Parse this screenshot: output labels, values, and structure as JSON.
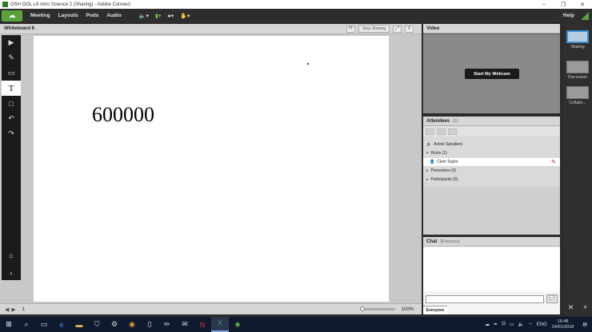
{
  "window": {
    "title": "OSH OOL L6 Intro Science 2 (Sharing) - Adobe Connect",
    "controls": [
      "–",
      "❐",
      "✕"
    ]
  },
  "menubar": {
    "items": [
      "Meeting",
      "Layouts",
      "Pods",
      "Audio"
    ],
    "help": "Help"
  },
  "whiteboard": {
    "title": "Whiteboard 6",
    "stop_sharing": "Stop Sharing",
    "content_text": "600000",
    "page": "1",
    "zoom": "100%",
    "zoom_level_fraction": 0.0
  },
  "video": {
    "title": "Video",
    "start_webcam": "Start My Webcam"
  },
  "attendees": {
    "title": "Attendees",
    "count": "(1)",
    "active_speakers": "Active Speakers",
    "groups": [
      {
        "label": "Hosts (1)"
      },
      {
        "label": "Presenters (0)"
      },
      {
        "label": "Participants (0)"
      }
    ],
    "hosts": [
      "Clem Taylor"
    ]
  },
  "chat": {
    "title": "Chat",
    "sub": "(Everyone)",
    "tab": "Everyone"
  },
  "layouts": [
    {
      "label": "Sharing",
      "active": true
    },
    {
      "label": "Discussion",
      "active": false
    },
    {
      "label": "Collabo...",
      "active": false
    }
  ],
  "taskbar": {
    "lang": "ENG",
    "time": "16:48",
    "date": "24/01/2018"
  }
}
